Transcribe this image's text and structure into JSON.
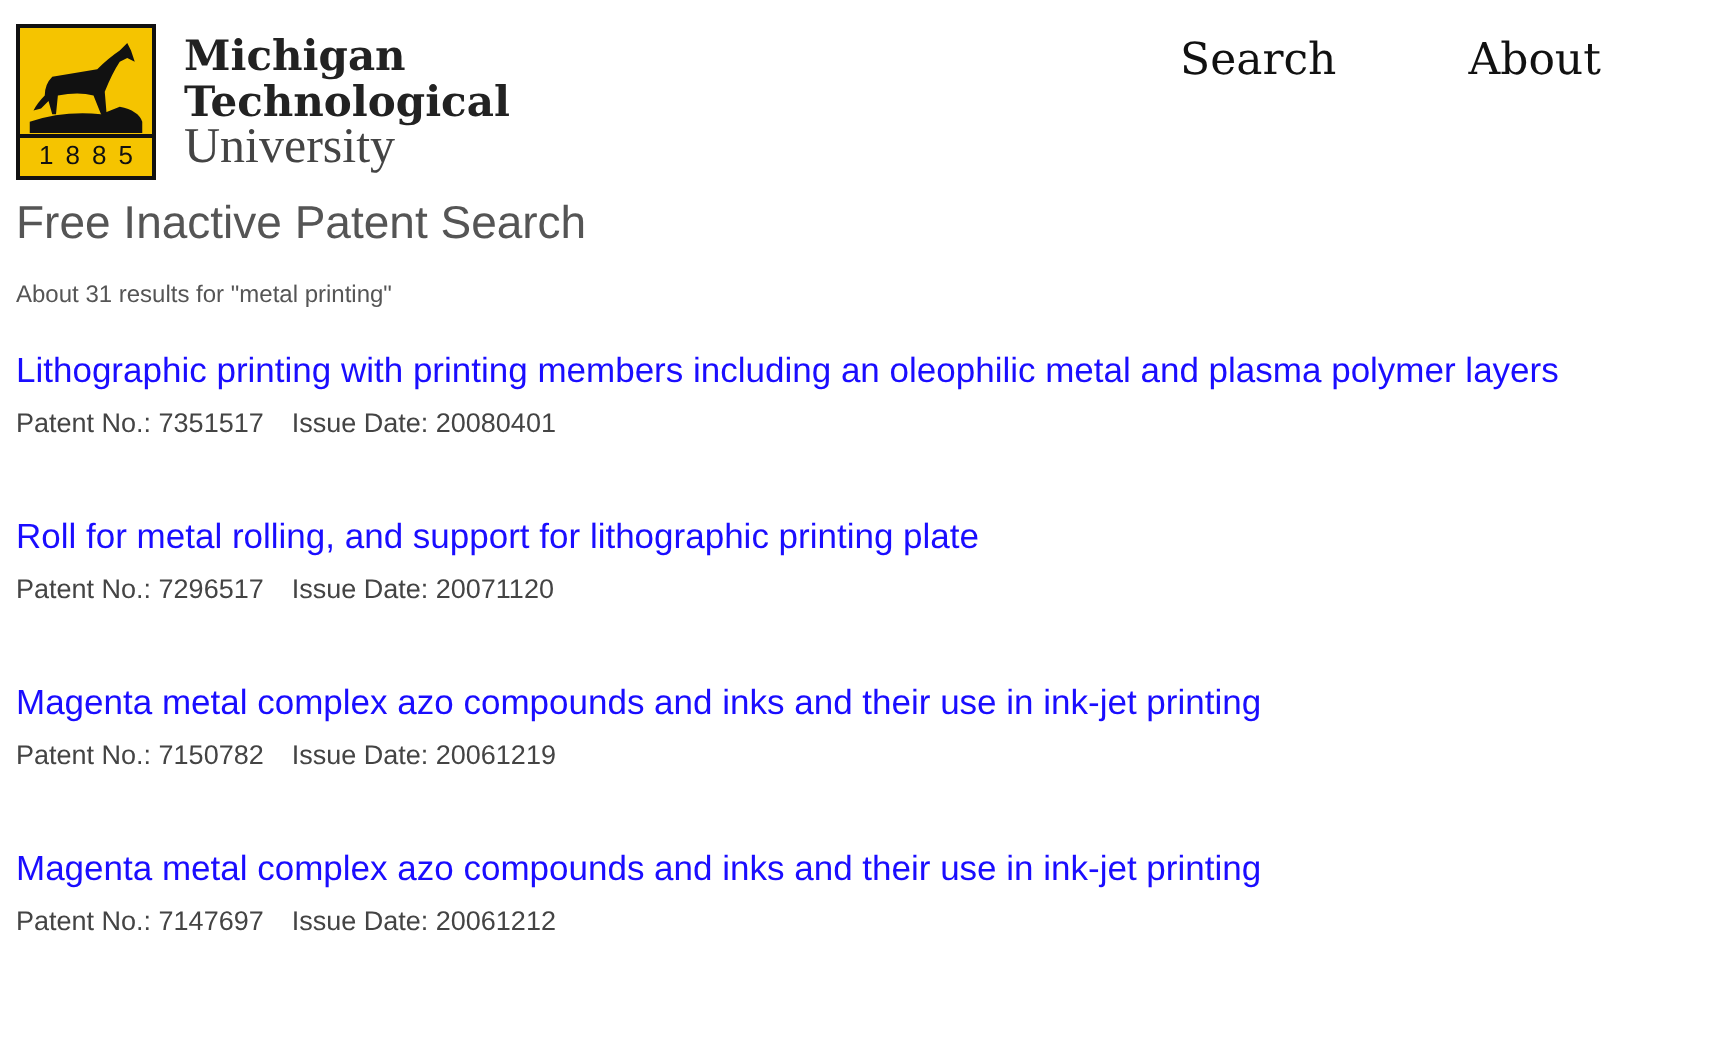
{
  "logo": {
    "year": "1885",
    "lines": [
      "Michigan",
      "Technological",
      "University"
    ]
  },
  "nav": [
    "Search",
    "About"
  ],
  "site_title": "Free Inactive Patent Search",
  "summary": "About 31 results for \"metal printing\"",
  "results": [
    {
      "title": "Lithographic printing with printing members including an oleophilic metal and plasma polymer layers",
      "patent_no": "Patent No.: 7351517",
      "issue_date": "Issue Date: 20080401"
    },
    {
      "title": "Roll for metal rolling, and support for lithographic printing plate",
      "patent_no": "Patent No.: 7296517",
      "issue_date": "Issue Date: 20071120"
    },
    {
      "title": "Magenta metal complex azo compounds and inks and their use in ink-jet printing",
      "patent_no": "Patent No.: 7150782",
      "issue_date": "Issue Date: 20061219"
    },
    {
      "title": "Magenta metal complex azo compounds and inks and their use in ink-jet printing",
      "patent_no": "Patent No.: 7147697",
      "issue_date": "Issue Date: 20061212"
    }
  ]
}
